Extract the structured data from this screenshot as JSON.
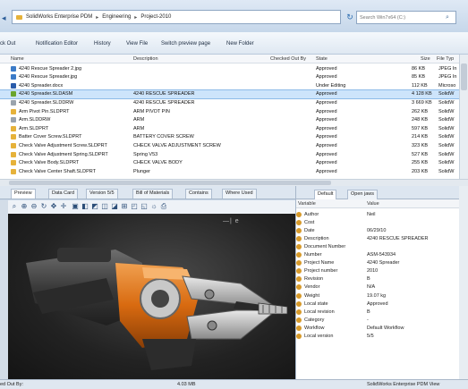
{
  "breadcrumb": [
    "SolidWorks Enterprise PDM",
    "Engineering",
    "Project-2010"
  ],
  "search": {
    "placeholder": "Search Win7x64 (C:)"
  },
  "toolbar": {
    "check_out": "ck Out",
    "notification_editor": "Notification Editor",
    "history": "History",
    "view_file": "View File",
    "switch_preview": "Switch preview page",
    "new_folder": "New Folder"
  },
  "file_columns": {
    "name": "Name",
    "description": "Description",
    "checked_out_by": "Checked Out By",
    "state": "State",
    "size": "Size",
    "file_type": "File Typ"
  },
  "files": [
    {
      "name": "4240 Rescue Spreader 2.jpg",
      "description": "",
      "state": "Approved",
      "size": "86 KB",
      "type": "JPEG In",
      "kind": "image"
    },
    {
      "name": "4240 Rescue Spreader.jpg",
      "description": "",
      "state": "Approved",
      "size": "85 KB",
      "type": "JPEG In",
      "kind": "image"
    },
    {
      "name": "4240 Spreader.docx",
      "description": "",
      "state": "Under Editing",
      "size": "112 KB",
      "type": "Microso",
      "kind": "doc"
    },
    {
      "name": "4240 Spreader.SLDASM",
      "description": "4240 RESCUE SPREADER",
      "state": "Approved",
      "size": "4 128 KB",
      "type": "SolidW",
      "kind": "asm",
      "selected": true
    },
    {
      "name": "4240 Spreader.SLDDRW",
      "description": "4240 RESCUE SPREADER",
      "state": "Approved",
      "size": "3 669 KB",
      "type": "SolidW",
      "kind": "drw"
    },
    {
      "name": "Arm Pivot Pin.SLDPRT",
      "description": "ARM PIVOT PIN",
      "state": "Approved",
      "size": "262 KB",
      "type": "SolidW",
      "kind": "part"
    },
    {
      "name": "Arm.SLDDRW",
      "description": "ARM",
      "state": "Approved",
      "size": "248 KB",
      "type": "SolidW",
      "kind": "drw"
    },
    {
      "name": "Arm.SLDPRT",
      "description": "ARM",
      "state": "Approved",
      "size": "597 KB",
      "type": "SolidW",
      "kind": "part"
    },
    {
      "name": "Batter Cover Screw.SLDPRT",
      "description": "BATTERY COVER SCREW",
      "state": "Approved",
      "size": "214 KB",
      "type": "SolidW",
      "kind": "part"
    },
    {
      "name": "Check Valve Adjustment Screw.SLDPRT",
      "description": "CHECK VALVE ADJUSTMENT SCREW",
      "state": "Approved",
      "size": "323 KB",
      "type": "SolidW",
      "kind": "part"
    },
    {
      "name": "Check Valve Adjustment Spring.SLDPRT",
      "description": "Spring V53",
      "state": "Approved",
      "size": "527 KB",
      "type": "SolidW",
      "kind": "part"
    },
    {
      "name": "Check Valve Body.SLDPRT",
      "description": "CHECK VALVE BODY",
      "state": "Approved",
      "size": "255 KB",
      "type": "SolidW",
      "kind": "part"
    },
    {
      "name": "Check Valve Center Shaft.SLDPRT",
      "description": "Plunger",
      "state": "Approved",
      "size": "203 KB",
      "type": "SolidW",
      "kind": "part"
    }
  ],
  "preview_tabs": [
    "Preview",
    "Data Card",
    "Version 5/5",
    "Bill of Materials",
    "Contains",
    "Where Used"
  ],
  "preview_size": "4.03 MB",
  "preview_watermark": "—| e",
  "props_tabs": {
    "default": "Default",
    "open_jaws": "Open jaws"
  },
  "props_columns": {
    "variable": "Variable",
    "value": "Value"
  },
  "properties": [
    {
      "name": "Author",
      "value": "Neil"
    },
    {
      "name": "Cost",
      "value": ""
    },
    {
      "name": "Date",
      "value": "06/29/10"
    },
    {
      "name": "Description",
      "value": "4240 RESCUE SPREADER"
    },
    {
      "name": "Document Number",
      "value": ""
    },
    {
      "name": "Number",
      "value": "ASM-543934"
    },
    {
      "name": "Project Name",
      "value": "4240 Spreader"
    },
    {
      "name": "Project number",
      "value": "2010"
    },
    {
      "name": "Revision",
      "value": "B"
    },
    {
      "name": "Vendor",
      "value": "N/A"
    },
    {
      "name": "Weight",
      "value": "19.07 kg"
    },
    {
      "name": "Local state",
      "value": "Approved"
    },
    {
      "name": "Local revision",
      "value": "B"
    },
    {
      "name": "Category",
      "value": "-"
    },
    {
      "name": "Workflow",
      "value": "Default Workflow"
    },
    {
      "name": "Local version",
      "value": "5/5"
    }
  ],
  "status": {
    "checked_out_by": "ed Out By:",
    "size": "4.03 MB",
    "app": "SolidWorks Enterprise PDM View"
  },
  "colors": {
    "selection": "#cde4fb",
    "accent_orange": "#e07a1f",
    "folder_yellow": "#e6b23a"
  }
}
